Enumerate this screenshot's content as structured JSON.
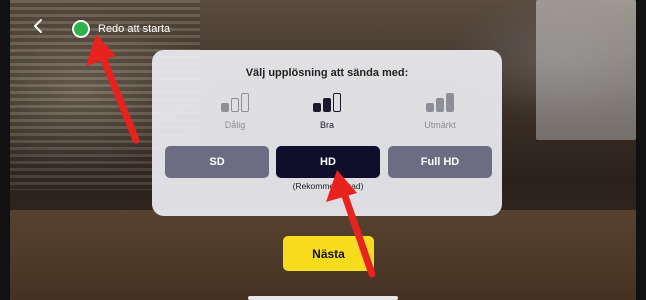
{
  "status": {
    "text": "Redo att starta",
    "color": "#2fb24c"
  },
  "back_icon": "chevron-left-icon",
  "dialog": {
    "title": "Välj upplösning att sända med:",
    "qualities": [
      {
        "label": "Dålig",
        "level": 1,
        "active": false
      },
      {
        "label": "Bra",
        "level": 2,
        "active": true
      },
      {
        "label": "Utmärkt",
        "level": 3,
        "active": false
      }
    ],
    "buttons": [
      {
        "label": "SD",
        "selected": false
      },
      {
        "label": "HD",
        "selected": true
      },
      {
        "label": "Full HD",
        "selected": false
      }
    ],
    "recommended": "(Rekommenderad)"
  },
  "next_button": {
    "label": "Nästa",
    "color": "#f7dc1d"
  },
  "colors": {
    "selected_button": "#0f0f2c",
    "unselected_button": "#6c6d82",
    "annotation_arrow": "#e8231f"
  }
}
